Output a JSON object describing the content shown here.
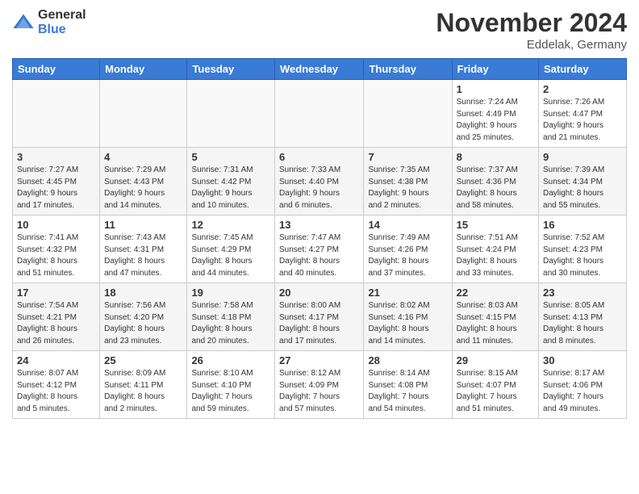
{
  "header": {
    "logo_general": "General",
    "logo_blue": "Blue",
    "month_title": "November 2024",
    "location": "Eddelak, Germany"
  },
  "days_of_week": [
    "Sunday",
    "Monday",
    "Tuesday",
    "Wednesday",
    "Thursday",
    "Friday",
    "Saturday"
  ],
  "weeks": [
    [
      {
        "day": "",
        "info": ""
      },
      {
        "day": "",
        "info": ""
      },
      {
        "day": "",
        "info": ""
      },
      {
        "day": "",
        "info": ""
      },
      {
        "day": "",
        "info": ""
      },
      {
        "day": "1",
        "info": "Sunrise: 7:24 AM\nSunset: 4:49 PM\nDaylight: 9 hours\nand 25 minutes."
      },
      {
        "day": "2",
        "info": "Sunrise: 7:26 AM\nSunset: 4:47 PM\nDaylight: 9 hours\nand 21 minutes."
      }
    ],
    [
      {
        "day": "3",
        "info": "Sunrise: 7:27 AM\nSunset: 4:45 PM\nDaylight: 9 hours\nand 17 minutes."
      },
      {
        "day": "4",
        "info": "Sunrise: 7:29 AM\nSunset: 4:43 PM\nDaylight: 9 hours\nand 14 minutes."
      },
      {
        "day": "5",
        "info": "Sunrise: 7:31 AM\nSunset: 4:42 PM\nDaylight: 9 hours\nand 10 minutes."
      },
      {
        "day": "6",
        "info": "Sunrise: 7:33 AM\nSunset: 4:40 PM\nDaylight: 9 hours\nand 6 minutes."
      },
      {
        "day": "7",
        "info": "Sunrise: 7:35 AM\nSunset: 4:38 PM\nDaylight: 9 hours\nand 2 minutes."
      },
      {
        "day": "8",
        "info": "Sunrise: 7:37 AM\nSunset: 4:36 PM\nDaylight: 8 hours\nand 58 minutes."
      },
      {
        "day": "9",
        "info": "Sunrise: 7:39 AM\nSunset: 4:34 PM\nDaylight: 8 hours\nand 55 minutes."
      }
    ],
    [
      {
        "day": "10",
        "info": "Sunrise: 7:41 AM\nSunset: 4:32 PM\nDaylight: 8 hours\nand 51 minutes."
      },
      {
        "day": "11",
        "info": "Sunrise: 7:43 AM\nSunset: 4:31 PM\nDaylight: 8 hours\nand 47 minutes."
      },
      {
        "day": "12",
        "info": "Sunrise: 7:45 AM\nSunset: 4:29 PM\nDaylight: 8 hours\nand 44 minutes."
      },
      {
        "day": "13",
        "info": "Sunrise: 7:47 AM\nSunset: 4:27 PM\nDaylight: 8 hours\nand 40 minutes."
      },
      {
        "day": "14",
        "info": "Sunrise: 7:49 AM\nSunset: 4:26 PM\nDaylight: 8 hours\nand 37 minutes."
      },
      {
        "day": "15",
        "info": "Sunrise: 7:51 AM\nSunset: 4:24 PM\nDaylight: 8 hours\nand 33 minutes."
      },
      {
        "day": "16",
        "info": "Sunrise: 7:52 AM\nSunset: 4:23 PM\nDaylight: 8 hours\nand 30 minutes."
      }
    ],
    [
      {
        "day": "17",
        "info": "Sunrise: 7:54 AM\nSunset: 4:21 PM\nDaylight: 8 hours\nand 26 minutes."
      },
      {
        "day": "18",
        "info": "Sunrise: 7:56 AM\nSunset: 4:20 PM\nDaylight: 8 hours\nand 23 minutes."
      },
      {
        "day": "19",
        "info": "Sunrise: 7:58 AM\nSunset: 4:18 PM\nDaylight: 8 hours\nand 20 minutes."
      },
      {
        "day": "20",
        "info": "Sunrise: 8:00 AM\nSunset: 4:17 PM\nDaylight: 8 hours\nand 17 minutes."
      },
      {
        "day": "21",
        "info": "Sunrise: 8:02 AM\nSunset: 4:16 PM\nDaylight: 8 hours\nand 14 minutes."
      },
      {
        "day": "22",
        "info": "Sunrise: 8:03 AM\nSunset: 4:15 PM\nDaylight: 8 hours\nand 11 minutes."
      },
      {
        "day": "23",
        "info": "Sunrise: 8:05 AM\nSunset: 4:13 PM\nDaylight: 8 hours\nand 8 minutes."
      }
    ],
    [
      {
        "day": "24",
        "info": "Sunrise: 8:07 AM\nSunset: 4:12 PM\nDaylight: 8 hours\nand 5 minutes."
      },
      {
        "day": "25",
        "info": "Sunrise: 8:09 AM\nSunset: 4:11 PM\nDaylight: 8 hours\nand 2 minutes."
      },
      {
        "day": "26",
        "info": "Sunrise: 8:10 AM\nSunset: 4:10 PM\nDaylight: 7 hours\nand 59 minutes."
      },
      {
        "day": "27",
        "info": "Sunrise: 8:12 AM\nSunset: 4:09 PM\nDaylight: 7 hours\nand 57 minutes."
      },
      {
        "day": "28",
        "info": "Sunrise: 8:14 AM\nSunset: 4:08 PM\nDaylight: 7 hours\nand 54 minutes."
      },
      {
        "day": "29",
        "info": "Sunrise: 8:15 AM\nSunset: 4:07 PM\nDaylight: 7 hours\nand 51 minutes."
      },
      {
        "day": "30",
        "info": "Sunrise: 8:17 AM\nSunset: 4:06 PM\nDaylight: 7 hours\nand 49 minutes."
      }
    ]
  ]
}
